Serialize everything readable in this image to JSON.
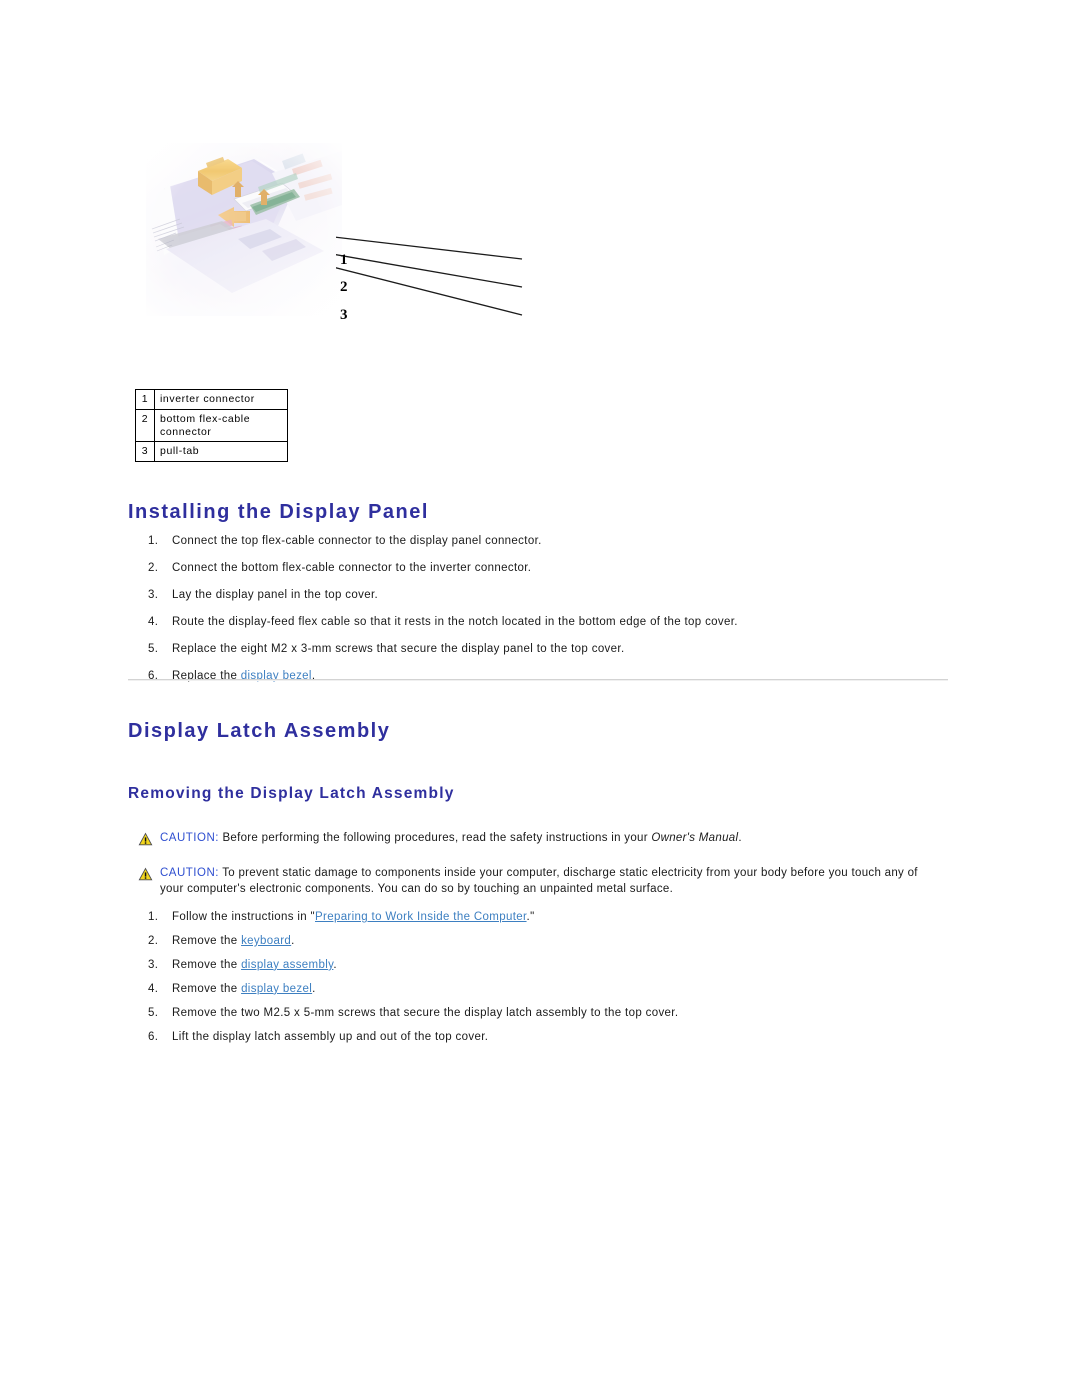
{
  "figure": {
    "alt": "Laptop top cover with display flex cables and inverter connector",
    "callouts": [
      {
        "number": "1"
      },
      {
        "number": "2"
      },
      {
        "number": "3"
      }
    ]
  },
  "legend": {
    "rows": [
      {
        "num": "1",
        "desc": "inverter connector"
      },
      {
        "num": "2",
        "desc": "bottom flex-cable connector"
      },
      {
        "num": "3",
        "desc": "pull-tab"
      }
    ]
  },
  "sections": {
    "installing": {
      "heading": "Installing the Display Panel",
      "steps": [
        {
          "marker": "1.",
          "pre": "Connect the top flex-cable connector to the display panel connector.",
          "link": "",
          "post": ""
        },
        {
          "marker": "2.",
          "pre": "Connect the bottom flex-cable connector to the inverter connector.",
          "link": "",
          "post": ""
        },
        {
          "marker": "3.",
          "pre": "Lay the display panel in the top cover.",
          "link": "",
          "post": ""
        },
        {
          "marker": "4.",
          "pre": "Route the display-feed flex cable so that it rests in the notch located in the bottom edge of the top cover.",
          "link": "",
          "post": ""
        },
        {
          "marker": "5.",
          "pre": "Replace the eight M2 x 3-mm screws that secure the display panel to the top cover.",
          "link": "",
          "post": ""
        },
        {
          "marker": "6.",
          "pre": "Replace the ",
          "link": "display bezel",
          "post": "."
        }
      ]
    },
    "latch": {
      "heading": "Display Latch Assembly",
      "removing": {
        "heading": "Removing the Display Latch Assembly",
        "cautions": [
          {
            "label": "CAUTION:",
            "text_before": " Before performing the following procedures, read the safety instructions in your ",
            "italic": "Owner's Manual",
            "text_after": "."
          },
          {
            "label": "CAUTION:",
            "text_before": " To prevent static damage to components inside your computer, discharge static electricity from your body before you touch any of your computer's electronic components. You can do so by touching an unpainted metal surface.",
            "italic": "",
            "text_after": ""
          }
        ],
        "steps": [
          {
            "marker": "1.",
            "pre": "Follow the instructions in \"",
            "link": "Preparing to Work Inside the Computer",
            "post": ".\""
          },
          {
            "marker": "2.",
            "pre": "Remove the ",
            "link": "keyboard",
            "post": "."
          },
          {
            "marker": "3.",
            "pre": "Remove the ",
            "link": "display assembly",
            "post": "."
          },
          {
            "marker": "4.",
            "pre": "Remove the ",
            "link": "display bezel",
            "post": "."
          },
          {
            "marker": "5.",
            "pre": "Remove the two M2.5 x 5-mm screws that secure the display latch assembly to the top cover.",
            "link": "",
            "post": ""
          },
          {
            "marker": "6.",
            "pre": "Lift the display latch assembly up and out of the top cover.",
            "link": "",
            "post": ""
          }
        ]
      }
    }
  },
  "colors": {
    "heading_blue": "#2f2f9e",
    "link_blue": "#3d7fc1",
    "caution_blue": "#2f4fd0",
    "warn_yellow": "#f2d61e",
    "rule_gray": "#d3d3d3"
  }
}
